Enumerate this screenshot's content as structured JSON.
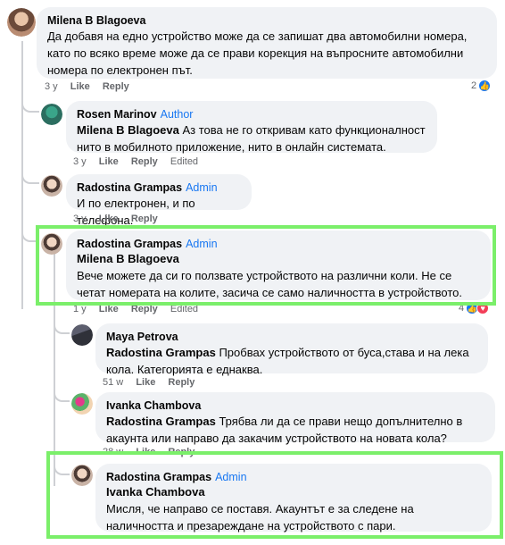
{
  "comments": [
    {
      "author": "Milena B Blagoeva",
      "text": "Да добавя на едно устройство може да се запишат два автомобилни номера, като по всяко време може да се прави корекция на въпросните автомобилни номера по електронен път.",
      "time": "3 y",
      "like": "Like",
      "reply": "Reply",
      "reactions": "2"
    },
    {
      "author": "Rosen Marinov",
      "role": "Author",
      "mention": "Milena B Blagoeva",
      "text": " Аз това не го откривам като функционалност нито в мобилното приложение, нито в онлайн системата.",
      "time": "3 y",
      "like": "Like",
      "reply": "Reply",
      "edited": "Edited"
    },
    {
      "author": "Radostina Grampas",
      "role": "Admin",
      "text": "И по електронен, и по телефона.",
      "time": "3 y",
      "like": "Like",
      "reply": "Reply"
    },
    {
      "author": "Radostina Grampas",
      "role": "Admin",
      "mention": "Milena B Blagoeva",
      "text": "Вече можете да си го ползвате устройството на различни коли. Не се четат номерата на колите, засича се само наличността в устройството.",
      "time": "1 y",
      "like": "Like",
      "reply": "Reply",
      "edited": "Edited",
      "reactions": "4"
    },
    {
      "author": "Maya Petrova",
      "mention": "Radostina Grampas",
      "text": " Пробвах устройството от буса,става и на лека кола. Категорията е еднаква.",
      "time": "51 w",
      "like": "Like",
      "reply": "Reply"
    },
    {
      "author": "Ivanka Chambova",
      "mention": "Radostina Grampas",
      "text": " Трябва ли да се прави нещо допълнително в акаунта или направо да закачим устройството на новата кола?",
      "time": "28 w",
      "like": "Like",
      "reply": "Reply"
    },
    {
      "author": "Radostina Grampas",
      "role": "Admin",
      "mention": "Ivanka Chambova",
      "text": "Мисля, че направо се поставя. Акаунтът е за следене на наличността и презареждане на устройството с пари."
    }
  ],
  "colors": {
    "highlight": "#7bef6a",
    "bubble": "#f0f2f5",
    "link": "#1877f2",
    "meta": "#65676b"
  }
}
